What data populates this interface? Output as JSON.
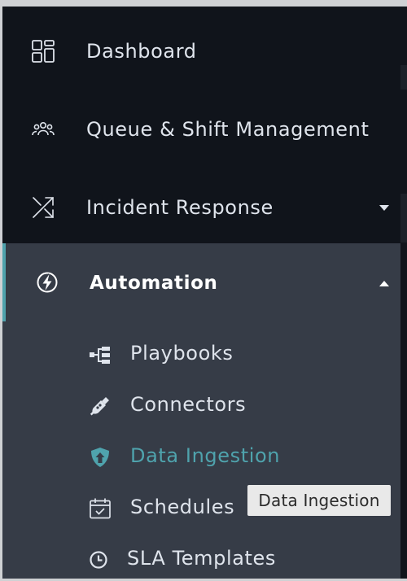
{
  "nav": {
    "items": [
      {
        "label": "Dashboard",
        "icon": "dashboard-grid-icon"
      },
      {
        "label": "Queue & Shift Management",
        "icon": "team-icon"
      },
      {
        "label": "Incident Response",
        "icon": "shuffle-arrows-icon",
        "expanded": false
      }
    ],
    "automation": {
      "label": "Automation",
      "icon": "bolt-circle-icon",
      "expanded": true,
      "children": [
        {
          "label": "Playbooks",
          "icon": "playbook-tree-icon"
        },
        {
          "label": "Connectors",
          "icon": "plug-icon"
        },
        {
          "label": "Data Ingestion",
          "icon": "upload-shield-icon",
          "active": true
        },
        {
          "label": "Schedules",
          "icon": "calendar-check-icon"
        },
        {
          "label": "SLA Templates",
          "icon": "clock-icon"
        }
      ]
    }
  },
  "tooltip": {
    "text": "Data Ingestion"
  },
  "colors": {
    "sidebar_bg": "#10141b",
    "section_bg": "#363c47",
    "accent": "#4fa3ad",
    "text": "#dfe4ec"
  }
}
